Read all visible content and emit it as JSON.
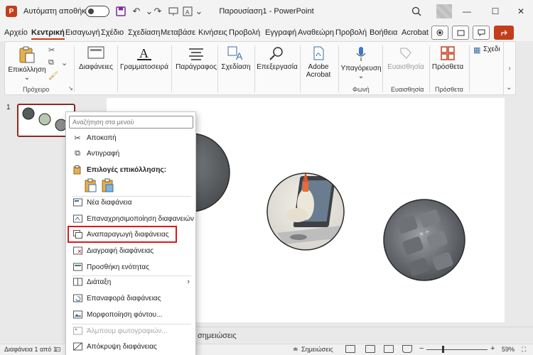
{
  "titlebar": {
    "app_logo": "P",
    "autosave_label": "Αυτόματη αποθήκευση",
    "autosave_state": "off",
    "document_title": "Παρουσίαση1  -  PowerPoint"
  },
  "tabs": [
    "Αρχείο",
    "Κεντρική",
    "Εισαγωγή",
    "Σχέδιο",
    "Σχεδίαση",
    "Μεταβάσε",
    "Κινήσεις",
    "Προβολή",
    "Εγγραφή",
    "Αναθεώρη",
    "Προβολή",
    "Βοήθεια",
    "Acrobat"
  ],
  "active_tab": "Κεντρική",
  "ribbon": {
    "paste": "Επικόλληση",
    "slides": "Διαφάνειες",
    "font": "Γραμματοσειρά",
    "paragraph": "Παράγραφος",
    "drawing": "Σχεδίαση",
    "editing": "Επεξεργασία",
    "acrobat_line1": "Adobe",
    "acrobat_line2": "Acrobat",
    "dictate": "Υπαγόρευση",
    "sensitivity": "Ευαισθησία",
    "addins": "Πρόσθετα",
    "designer": "Σχεδι",
    "group_clipboard": "Πρόχειρο",
    "group_voice": "Φωνή",
    "group_sensitivity": "Ευαισθησία",
    "group_addins": "Πρόσθετα"
  },
  "thumbnails": {
    "slide_number": "1"
  },
  "context_menu": {
    "search_placeholder": "Αναζήτηση στα μενού",
    "items": [
      {
        "label": "Αποκοπή",
        "icon": "scissors-icon"
      },
      {
        "label": "Αντιγραφή",
        "icon": "copy-icon"
      },
      {
        "label": "Επιλογές επικόλλησης:",
        "icon": "paste-icon"
      },
      {
        "label": "Νέα διαφάνεια",
        "icon": "new-slide-icon"
      },
      {
        "label": "Επαναχρησιμοποίηση διαφανειών",
        "icon": "reuse-slides-icon"
      },
      {
        "label": "Αναπαραγωγή διαφάνειας",
        "icon": "duplicate-slide-icon"
      },
      {
        "label": "Διαγραφή διαφάνειας",
        "icon": "delete-slide-icon"
      },
      {
        "label": "Προσθήκη ενότητας",
        "icon": "add-section-icon"
      },
      {
        "label": "Διάταξη",
        "icon": "layout-icon"
      },
      {
        "label": "Επαναφορά διαφάνειας",
        "icon": "reset-slide-icon"
      },
      {
        "label": "Μορφοποίηση φόντου...",
        "icon": "format-background-icon"
      },
      {
        "label": "Άλμπουμ φωτογραφιών...",
        "icon": "photo-album-icon"
      },
      {
        "label": "Απόκρυψη διαφάνειας",
        "icon": "hide-slide-icon"
      }
    ]
  },
  "notes_prompt": "σημειώσεις",
  "statusbar": {
    "slide_info": "Διαφάνεια 1 από 1",
    "notes_button": "Σημειώσεις",
    "zoom_minus": "−",
    "zoom_plus": "+",
    "zoom_level": "59%"
  },
  "colors": {
    "accent": "#c43e1c",
    "highlight_border": "#e01818",
    "thumb_border": "#8a2d20"
  }
}
